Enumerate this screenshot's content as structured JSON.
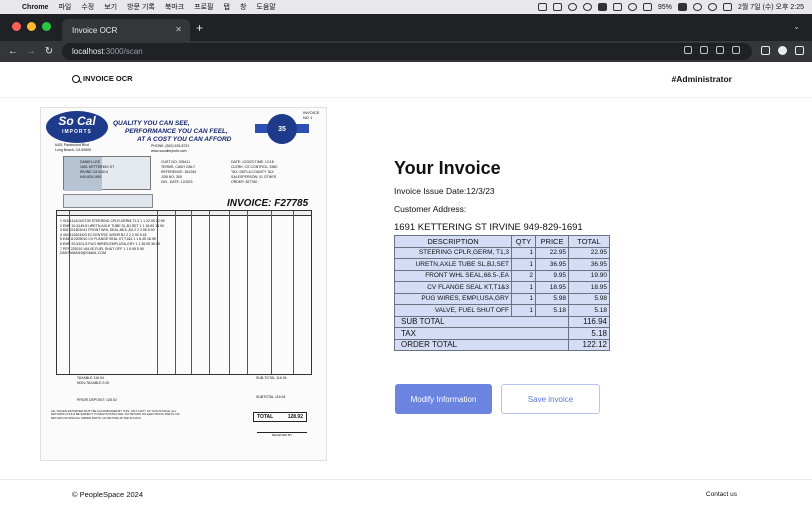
{
  "menubar": {
    "app": "Chrome",
    "items": [
      "파일",
      "수정",
      "보기",
      "방문 기록",
      "북마크",
      "프로필",
      "탭",
      "창",
      "도움말"
    ],
    "battery": "95%",
    "clock": "2월 7일 (수) 오후 2:25"
  },
  "browser": {
    "tab_title": "Invoice OCR",
    "url_host": "localhost",
    "url_path": ":3000/scan"
  },
  "header": {
    "brand": "INVOICE OCR",
    "role": "#Administrator"
  },
  "scan": {
    "logo_main": "So Cal",
    "logo_sub": "IMPORTS",
    "slogan": [
      "QUALITY YOU CAN SEE,",
      "PERFORMANCE YOU CAN FEEL,",
      "AT A COST YOU CAN AFFORD"
    ],
    "seal": "35",
    "invoice_no_label": "INVOICE NO 1",
    "address": [
      "6401 Paramount Blvd",
      "Long Beach, CA 90805"
    ],
    "phone": [
      "PHONE: (562) 633-8731",
      "www.socalimports.com"
    ],
    "mid_fields": [
      "CUST NO: 305411",
      "TERMS: CASH ONLY",
      "",
      "REFERENCE: 361264",
      "JOB NO: 305",
      "DEL. DATE: 12/3/23"
    ],
    "right_fields": [
      "DATE: 12/3/23  TIME: 12:18",
      "CLERK: CS  CONTROL: 3360",
      "TAX: DEFLA COUNTY TAX",
      "SALESPERSON: 01 OTHER",
      "",
      "ORDER: 827780"
    ],
    "customer": [
      "DANIEL LEE",
      "1691 KETTERING ST",
      "IRVINE  CA 92614",
      "949-829-1691"
    ],
    "title": "INVOICE: F27785",
    "rows": [
      "1  916  11141347139   STEERING CPLR,GERM,T1,3    1  1   22.95   22.95",
      "2  EMP  10-5149-8     URETN,AXLE TUBE SL,BJ,SET  1  1   18.90   18.90",
      "3  841  221601041     FRONT WHL SEAL,68.5-,EA    2  2    2.95    5.90",
      "4  400  113403423     ECCENTRIC WSHR BJ          2  2    2.90    5.18",
      "5  E46  112005010     CV FLANGE SEAL KT,T1&3     1  1    8.45   18.95",
      "6  EMP  20-5101-8     PUG WIRES,EMPI,USA,GRY     1  1   36.95   36.95",
      "7  PEF  225210        VALVE,FUEL SHUT OFF        1  1    5.95    5.95",
      "   DANTIWAN19@GMAIL.COM"
    ],
    "taxable": [
      "TAXABLE  116.94",
      "NON-TAXABLE  0.00"
    ],
    "subtotal_label": "SUB-TOTAL   116.94",
    "deposit": "PRIOR DEPOSIT:  128.92",
    "subtotal2": "SUBTOTAL   116.94",
    "total_label": "TOTAL",
    "total_value": "128.92",
    "signature": "RECEIVED BY"
  },
  "invoice": {
    "title": "Your Invoice",
    "issue_date_label": "Invoice Issue Date:",
    "issue_date": "12/3/23",
    "address_label": "Customer Address:",
    "address": "1691 KETTERING ST IRVINE 949-829-1691",
    "columns": [
      "DESCRIPTION",
      "QTY",
      "PRICE",
      "TOTAL"
    ],
    "items": [
      {
        "description": "STEERING CPLR,GERM, T1,3",
        "qty": "1",
        "price": "22.95",
        "total": "22.95"
      },
      {
        "description": "URETN,AXLE TUBE SL,BJ,SET",
        "qty": "1",
        "price": "36.95",
        "total": "36.95"
      },
      {
        "description": "FRONT WHL SEAL,68.5-,EA",
        "qty": "2",
        "price": "9.95",
        "total": "19.90"
      },
      {
        "description": "CV FLANGE SEAL KT,T1&3",
        "qty": "1",
        "price": "18.95",
        "total": "18.95"
      },
      {
        "description": "PUG WIRES, EMPI,USA,GRY",
        "qty": "1",
        "price": "5.98",
        "total": "5.98"
      },
      {
        "description": "VALVE, FUEL SHUT OFF",
        "qty": "1",
        "price": "5.18",
        "total": "5.18"
      }
    ],
    "subtotal_label": "SUB TOTAL",
    "subtotal": "116.94",
    "tax_label": "TAX",
    "tax": "5.18",
    "order_total_label": "ORDER TOTAL",
    "order_total": "122.12"
  },
  "actions": {
    "modify": "Modify Information",
    "save": "Save invoice"
  },
  "footer": {
    "copyright": "© PeopleSpace 2024",
    "contact": "Contact us"
  },
  "colors": {
    "primary_button": "#6a84e0",
    "table_bg": "#d5ddf6",
    "browser_dark": "#202124"
  }
}
